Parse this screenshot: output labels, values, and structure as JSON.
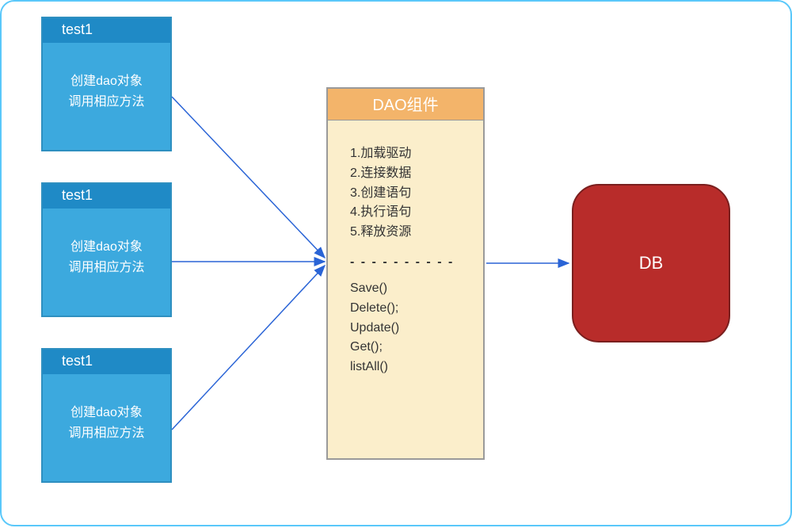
{
  "testBoxes": [
    {
      "header": "test1",
      "line1": "创建dao对象",
      "line2": "调用相应方法"
    },
    {
      "header": "test1",
      "line1": "创建dao对象",
      "line2": "调用相应方法"
    },
    {
      "header": "test1",
      "line1": "创建dao对象",
      "line2": "调用相应方法"
    }
  ],
  "dao": {
    "header": "DAO组件",
    "steps": [
      "1.加载驱动",
      "2.连接数据",
      "3.创建语句",
      "4.执行语句",
      "5.释放资源"
    ],
    "divider": "- - - - - - - - - -",
    "methods": [
      "Save()",
      "Delete();",
      "Update()",
      "Get();",
      "listAll()"
    ]
  },
  "db": {
    "label": "DB"
  },
  "colors": {
    "border": "#5ac8fa",
    "testFill": "#3ca9de",
    "testHeader": "#1f8ac6",
    "daoFill": "#fbeecb",
    "daoHeader": "#f3b46a",
    "dbFill": "#b82c2a",
    "arrow": "#2a64d6"
  }
}
